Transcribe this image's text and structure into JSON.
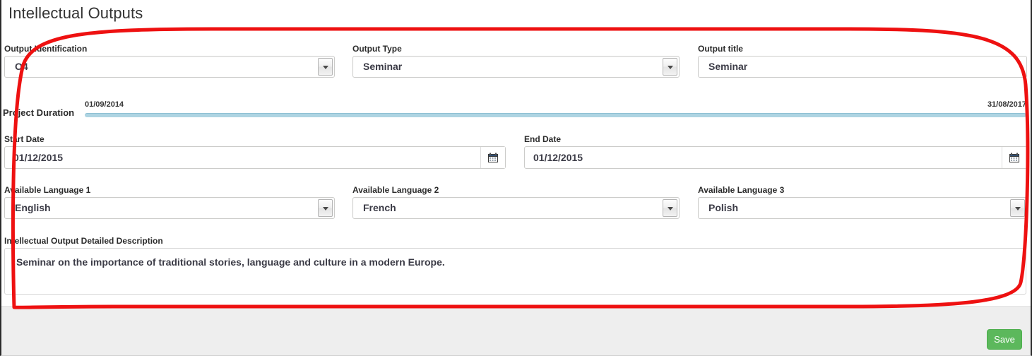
{
  "page": {
    "title": "Intellectual Outputs"
  },
  "fields": {
    "output_identification": {
      "label": "Output Identification",
      "value": "O4",
      "icon": "chevron-down-icon"
    },
    "output_type": {
      "label": "Output Type",
      "value": "Seminar",
      "icon": "chevron-down-icon"
    },
    "output_title": {
      "label": "Output title",
      "value": "Seminar",
      "placeholder": ""
    },
    "project_duration": {
      "label": "Project Duration",
      "start_tooltip": "01/09/2014",
      "end_tooltip": "31/08/2017",
      "track_color": "#aed4e2"
    },
    "start_date": {
      "label": "Start Date",
      "value": "01/12/2015",
      "icon": "calendar-icon"
    },
    "end_date": {
      "label": "End Date",
      "value": "01/12/2015",
      "icon": "calendar-icon"
    },
    "available_language_1": {
      "label": "Available Language 1",
      "value": "English",
      "icon": "chevron-down-icon"
    },
    "available_language_2": {
      "label": "Available Language 2",
      "value": "French",
      "icon": "chevron-down-icon"
    },
    "available_language_3": {
      "label": "Available Language 3",
      "value": "Polish",
      "icon": "chevron-down-icon"
    },
    "description": {
      "label": "Intellectual Output Detailed Description",
      "value": "Seminar on the importance of traditional stories, language and culture in a modern Europe.",
      "placeholder": ""
    }
  },
  "footer": {
    "save_label": "Save",
    "save_color": "#5cb85c"
  },
  "annotation": {
    "shape": "red-rounded-highlight",
    "color": "#ee1111"
  }
}
